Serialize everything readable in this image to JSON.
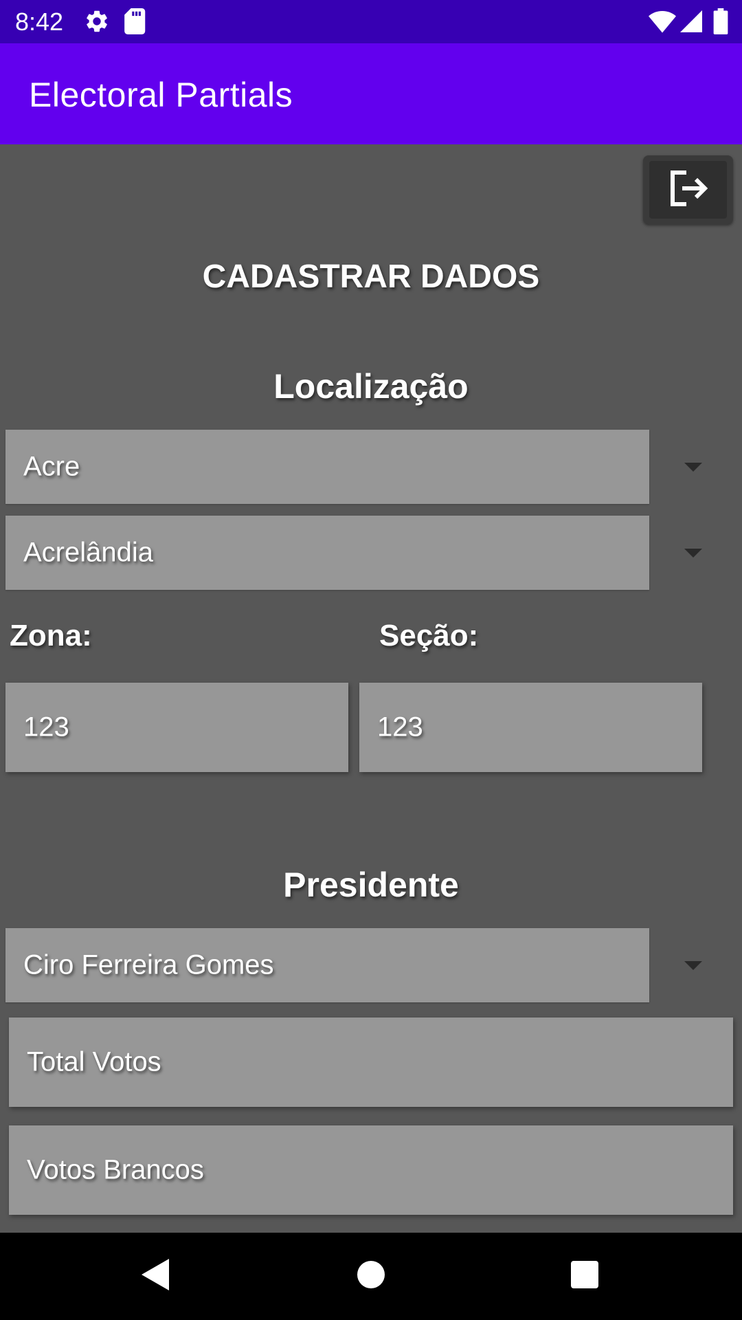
{
  "status_bar": {
    "time": "8:42",
    "icons": [
      "settings-icon",
      "sd-card-icon",
      "wifi-icon",
      "signal-icon",
      "battery-icon"
    ],
    "background": "#3700b3"
  },
  "app_bar": {
    "title": "Electoral Partials",
    "background": "#6200ee"
  },
  "toolbar": {
    "logout_icon": "logout-icon"
  },
  "form": {
    "title": "CADASTRAR DADOS",
    "location_heading": "Localização",
    "state_select": {
      "value": "Acre"
    },
    "city_select": {
      "value": "Acrelândia"
    },
    "zone": {
      "label": "Zona:",
      "value": "123"
    },
    "section": {
      "label": "Seção:",
      "value": "123"
    },
    "president_heading": "Presidente",
    "candidate_select": {
      "value": "Ciro Ferreira Gomes"
    },
    "total_votes": {
      "placeholder": "Total Votos"
    },
    "blank_votes": {
      "placeholder": "Votos Brancos"
    }
  },
  "nav_bar": {
    "buttons": [
      "back-icon",
      "home-icon",
      "recents-icon"
    ]
  },
  "colors": {
    "content_background": "#575757",
    "field_background": "#979797",
    "text": "#ffffff"
  }
}
